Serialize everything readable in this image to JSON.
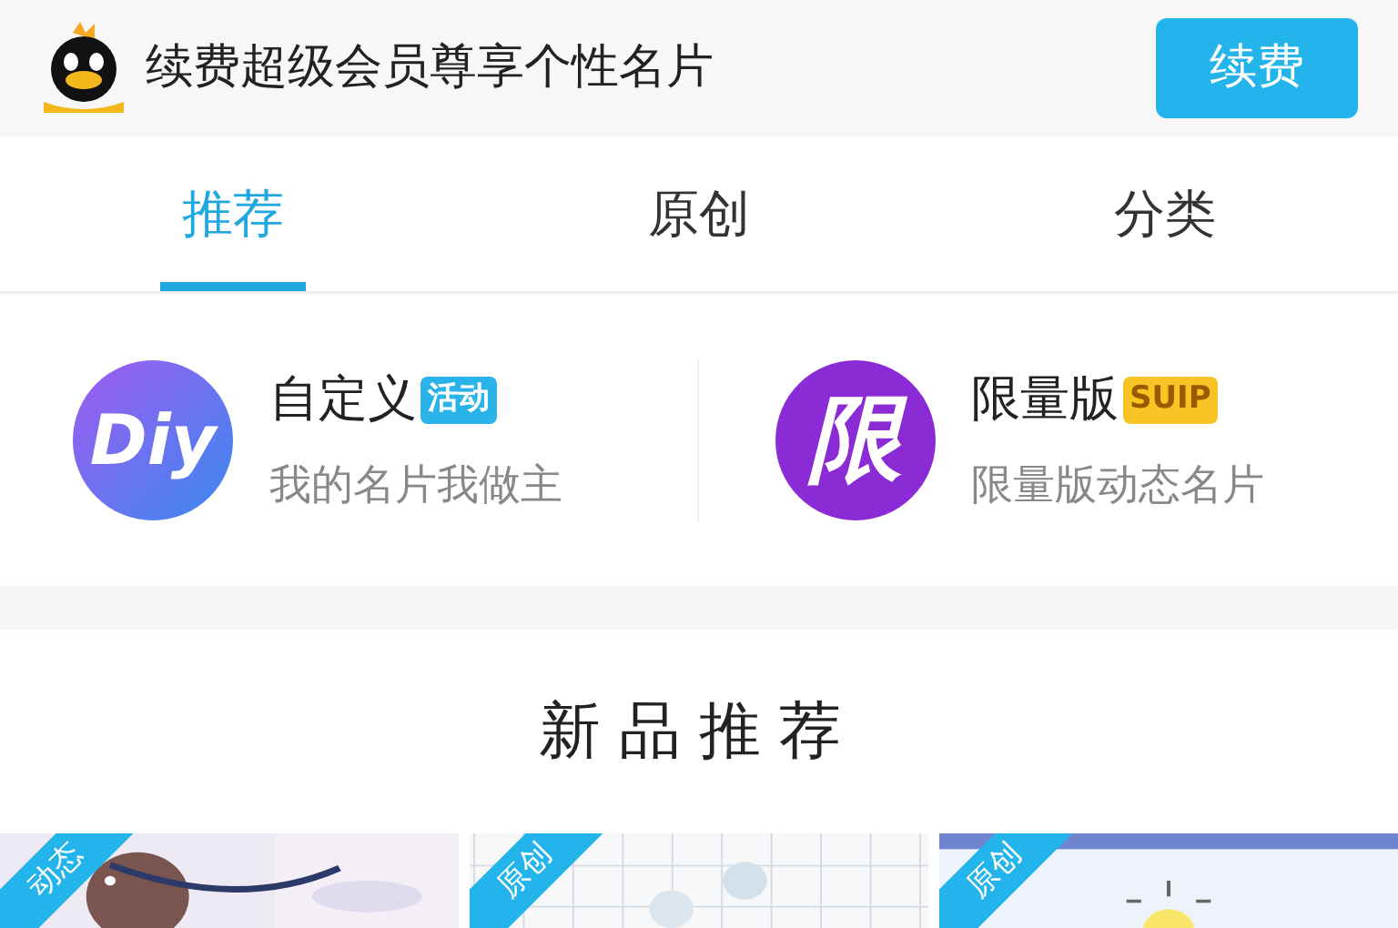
{
  "banner": {
    "text": "续费超级会员尊享个性名片",
    "button": "续费"
  },
  "tabs": [
    {
      "label": "推荐",
      "selected": true
    },
    {
      "label": "原创",
      "selected": false
    },
    {
      "label": "分类",
      "selected": false
    }
  ],
  "features": [
    {
      "icon_text": "Diy",
      "title": "自定义",
      "badge": "活动",
      "color": "#29b3e8",
      "subtitle": "我的名片我做主"
    },
    {
      "icon_text": "限",
      "title": "限量版",
      "badge": "SUIP",
      "color": "#f7c325",
      "subtitle": "限量版动态名片"
    }
  ],
  "section_title": "新品推荐",
  "cards": [
    {
      "tag": "动态"
    },
    {
      "tag": "原创"
    },
    {
      "tag": "原创"
    }
  ]
}
